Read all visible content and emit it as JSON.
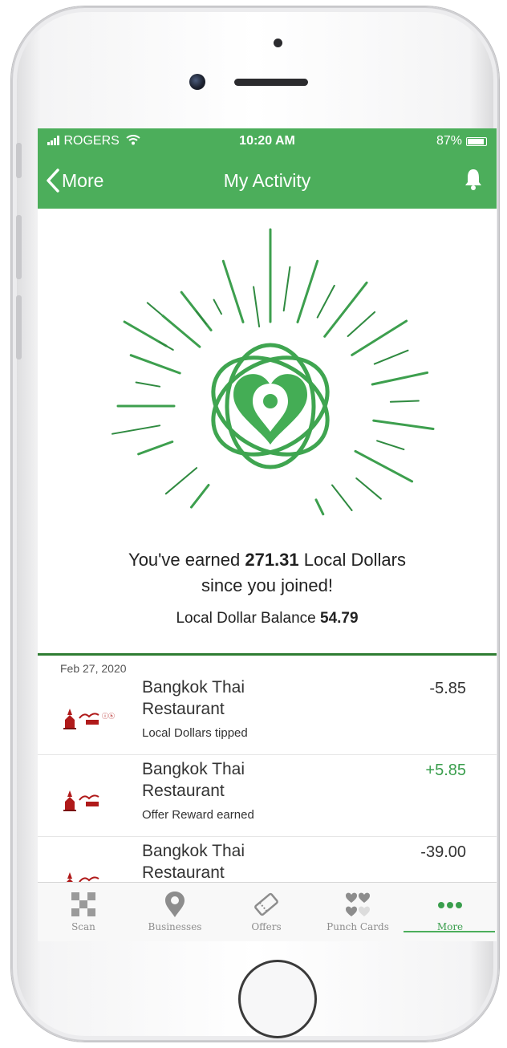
{
  "status": {
    "carrier": "ROGERS",
    "time": "10:20 AM",
    "battery": "87%"
  },
  "nav": {
    "back_label": "More",
    "title": "My Activity"
  },
  "summary": {
    "earned_prefix": "You've earned",
    "earned_amount": "271.31",
    "earned_suffix": "Local Dollars",
    "earned_line2": "since you joined!",
    "balance_label": "Local Dollar Balance",
    "balance_value": "54.79"
  },
  "activity": {
    "date": "Feb 27, 2020",
    "items": [
      {
        "name_line1": "Bangkok Thai",
        "name_line2": "Restaurant",
        "amount": "-5.85",
        "note": "Local Dollars tipped"
      },
      {
        "name_line1": "Bangkok Thai",
        "name_line2": "Restaurant",
        "amount": "+5.85",
        "note": "Offer Reward earned"
      },
      {
        "name_line1": "Bangkok Thai",
        "name_line2": "Restaurant",
        "amount": "-39.00",
        "note": ""
      }
    ]
  },
  "tabs": [
    {
      "label": "Scan",
      "icon": "qr-scan-icon"
    },
    {
      "label": "Businesses",
      "icon": "map-pin-icon"
    },
    {
      "label": "Offers",
      "icon": "ticket-icon"
    },
    {
      "label": "Punch Cards",
      "icon": "hearts-icon"
    },
    {
      "label": "More",
      "icon": "more-dots-icon"
    }
  ],
  "colors": {
    "brand_green": "#4cae5b",
    "positive": "#3a9e4d",
    "divider": "#2e7d32"
  }
}
